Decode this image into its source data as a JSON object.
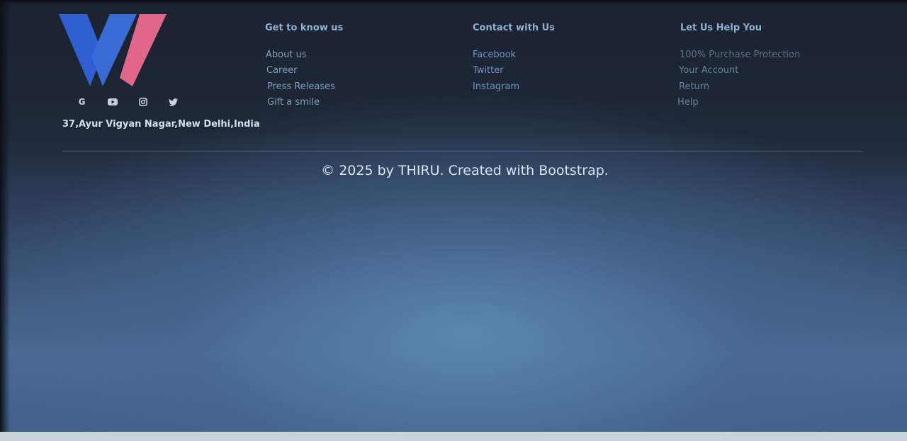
{
  "footer": {
    "brand": {
      "logo_colors": {
        "blue": "#2f5fd0",
        "pink": "#e0678a"
      },
      "address": "37,Ayur Vigyan Nagar,New Delhi,India",
      "socials": [
        {
          "icon": "google-icon",
          "glyph": "G"
        },
        {
          "icon": "youtube-icon",
          "glyph": "▶"
        },
        {
          "icon": "instagram-icon",
          "glyph": "◎"
        },
        {
          "icon": "twitter-icon",
          "glyph": "🐦"
        }
      ]
    },
    "columns": [
      {
        "heading": "Get to know us",
        "links": [
          "About us",
          "Career",
          "Press Releases",
          "Gift a smile"
        ]
      },
      {
        "heading": "Contact with Us",
        "links": [
          "Facebook",
          "Twitter",
          "Instagram"
        ]
      },
      {
        "heading": "Let Us Help You",
        "links": [
          "100% Purchase Protection",
          "Your Account",
          "Return",
          "Help"
        ]
      }
    ],
    "copyright": "© 2025 by THIRU. Created with Bootstrap."
  }
}
